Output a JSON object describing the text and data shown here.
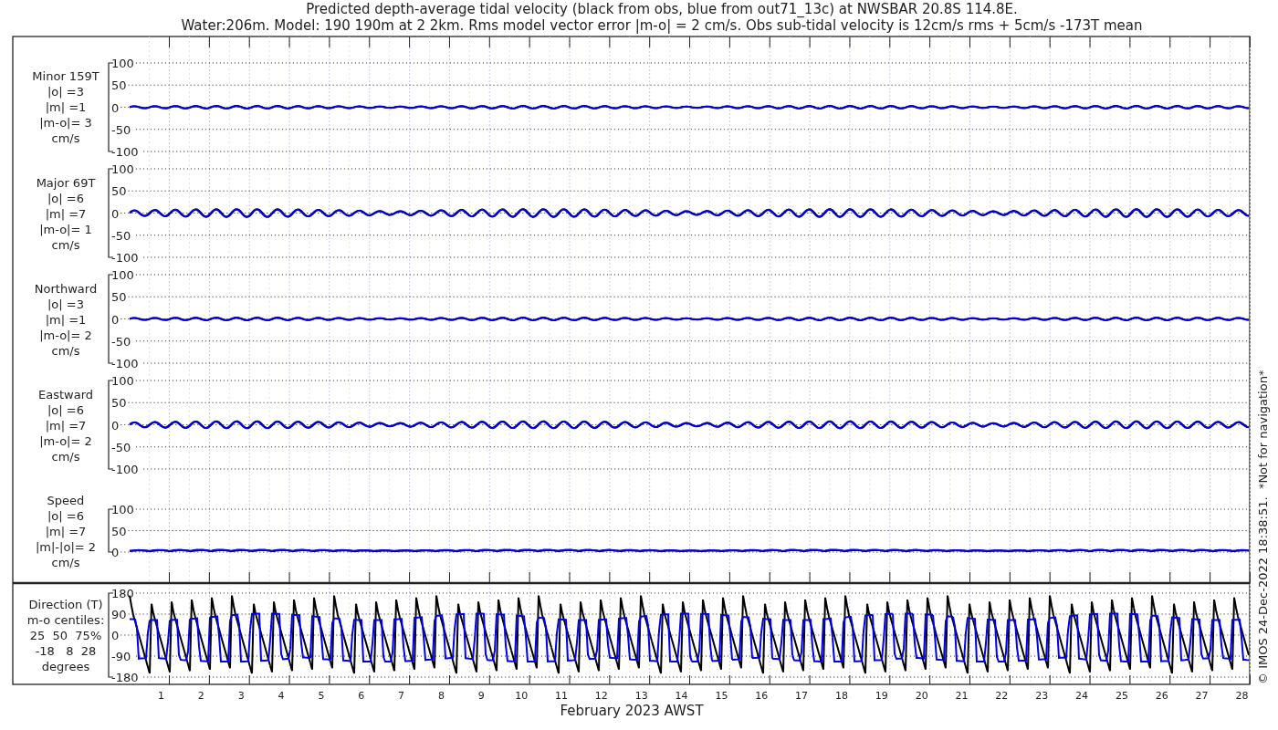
{
  "title_lines": [
    "Predicted depth-average tidal velocity (black from obs, blue from out71_13c) at NWSBAR 20.8S 114.8E.",
    "Water:206m. Model: 190 190m at 2 2km. Rms model vector error |m-o| = 2 cm/s. Obs sub-tidal velocity is 12cm/s rms + 5cm/s -173T mean"
  ],
  "panels": [
    {
      "kind": "vector",
      "label_lines": [
        "Minor 159T",
        "|o| =3",
        "|m| =1",
        "|m-o|= 3",
        "cm/s"
      ],
      "yticks": [
        "100",
        "50",
        "0",
        "-50",
        "-100"
      ]
    },
    {
      "kind": "vector",
      "label_lines": [
        "Major 69T",
        "|o| =6",
        "|m| =7",
        "|m-o|= 1",
        "cm/s"
      ],
      "yticks": [
        "100",
        "50",
        "0",
        "-50",
        "-100"
      ]
    },
    {
      "kind": "vector",
      "label_lines": [
        "Northward",
        "|o| =3",
        "|m| =1",
        "|m-o|= 2",
        "cm/s"
      ],
      "yticks": [
        "100",
        "50",
        "0",
        "-50",
        "-100"
      ]
    },
    {
      "kind": "vector",
      "label_lines": [
        "Eastward",
        "|o| =6",
        "|m| =7",
        "|m-o|= 2",
        "cm/s"
      ],
      "yticks": [
        "100",
        "50",
        "0",
        "-50",
        "-100"
      ]
    },
    {
      "kind": "speed",
      "label_lines": [
        "Speed",
        "|o| =6",
        "|m| =7",
        "|m|-|o|= 2",
        "cm/s"
      ],
      "yticks": [
        "100",
        "50",
        "0"
      ]
    },
    {
      "kind": "direction",
      "label_lines": [
        "Direction (T)",
        "m-o centiles:",
        "25  50  75%",
        "-18   8  28",
        "degrees"
      ],
      "yticks": [
        "180",
        "90",
        "0",
        "-90",
        "-180"
      ]
    }
  ],
  "x_tick_labels": [
    "1",
    "2",
    "3",
    "4",
    "5",
    "6",
    "7",
    "8",
    "9",
    "10",
    "11",
    "12",
    "13",
    "14",
    "15",
    "16",
    "17",
    "18",
    "19",
    "20",
    "21",
    "22",
    "23",
    "24",
    "25",
    "26",
    "27",
    "28"
  ],
  "xlabel": "February 2023 AWST",
  "credit": "© IMOS 24-Dec-2022 18:38:51.  *Not for navigation*"
}
